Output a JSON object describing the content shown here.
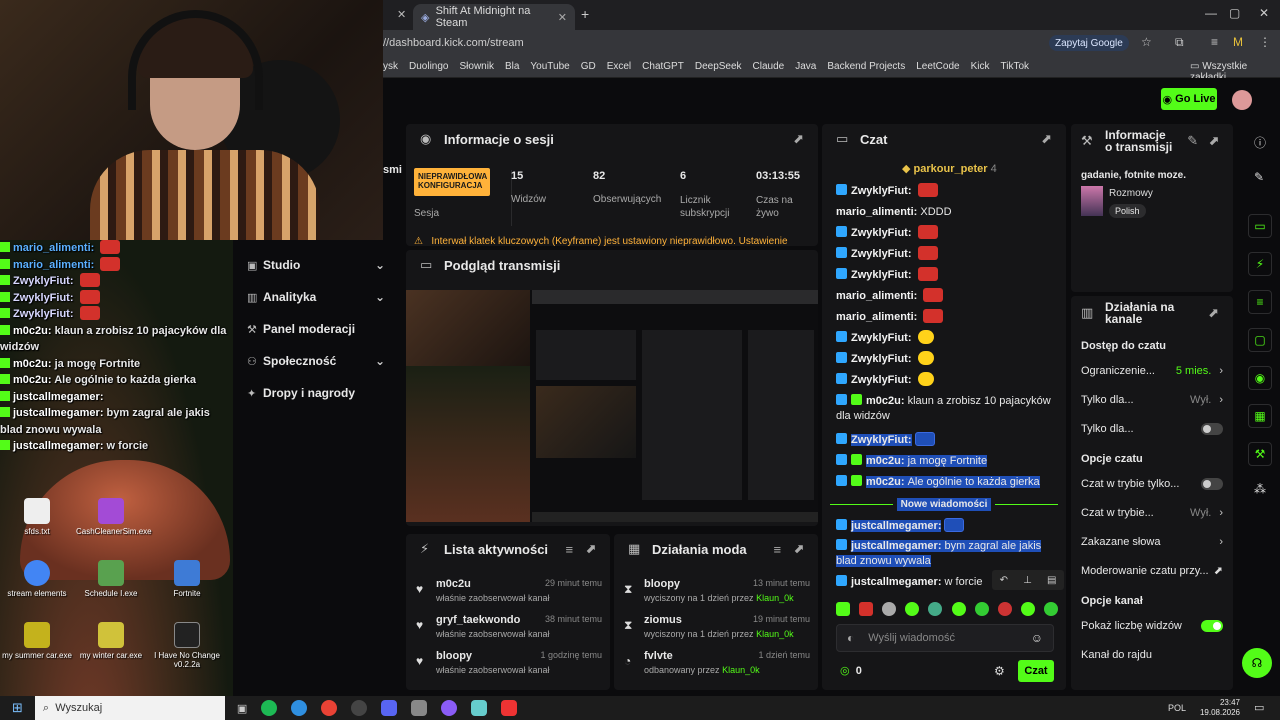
{
  "browser": {
    "tabs": [
      {
        "label": "Shift At Midnight na Steam"
      }
    ],
    "url": "//dashboard.kick.com/stream",
    "translate": "Zapytaj Google",
    "bookmarks": [
      "ysk",
      "Duolingo",
      "Słownik",
      "Bla",
      "YouTube",
      "GD",
      "Excel",
      "ChatGPT",
      "DeepSeek",
      "Claude",
      "Java",
      "Backend Projects",
      "LeetCode",
      "Kick",
      "TikTok"
    ],
    "all_bookmarks": "Wszystkie zakładki"
  },
  "header": {
    "go_live": "Go Live"
  },
  "overlay_chat": [
    {
      "user": "mario_alimenti:",
      "text": "",
      "emote": true
    },
    {
      "user": "mario_alimenti:",
      "text": "",
      "emote": true
    },
    {
      "user": "ZwyklyFiut:",
      "text": "",
      "emote": true
    },
    {
      "user": "ZwyklyFiut:",
      "text": "",
      "emote": true
    },
    {
      "user": "ZwyklyFiut:",
      "text": "",
      "emote": true
    },
    {
      "user": "m0c2u:",
      "text": "klaun a zrobisz 10 pajacyków dla widzów"
    },
    {
      "user": "m0c2u:",
      "text": "ja mogę Fortnite"
    },
    {
      "user": "m0c2u:",
      "text": "Ale ogólnie to każda gierka"
    },
    {
      "user": "justcallmegamer:",
      "text": ""
    },
    {
      "user": "justcallmegamer:",
      "text": "bym zagral ale jakis blad znowu wywala"
    },
    {
      "user": "justcallmegamer:",
      "text": "w forcie"
    }
  ],
  "desktop_icons": [
    "sfds.txt",
    "CashCleanerSim.exe",
    "stream elements",
    "Schedule I.exe",
    "Fortnite",
    "my summer car.exe",
    "my winter car.exe",
    "I Have No Change v0.2.2a"
  ],
  "nav": {
    "items": [
      {
        "label": "Studio",
        "has_arrow": true
      },
      {
        "label": "Analityka",
        "has_arrow": true
      },
      {
        "label": "Panel moderacji",
        "has_arrow": false
      },
      {
        "label": "Społeczność",
        "has_arrow": true
      },
      {
        "label": "Dropy i nagrody",
        "has_arrow": false
      }
    ]
  },
  "session": {
    "title": "Informacje o sesji",
    "status_badge": "NIEPRAWIDŁOWA KONFIGURACJA",
    "status_label": "Sesja",
    "stats": [
      {
        "value": "15",
        "label": "Widzów"
      },
      {
        "value": "82",
        "label": "Obserwujących"
      },
      {
        "value": "6",
        "label": "Licznik subskrypcji"
      },
      {
        "value": "03:13:55",
        "label": "Czas na żywo"
      }
    ],
    "warning": "Interwał klatek kluczowych (Keyframe) jest ustawiony nieprawidłowo. Ustawienie"
  },
  "preview": {
    "title": "Podgląd transmisji"
  },
  "activity": {
    "title": "Lista aktywności",
    "items": [
      {
        "name": "m0c2u",
        "desc": "właśnie zaobserwował kanał",
        "time": "29 minut temu"
      },
      {
        "name": "gryf_taekwondo",
        "desc": "właśnie zaobserwował kanał",
        "time": "38 minut temu"
      },
      {
        "name": "bloopy",
        "desc": "właśnie zaobserwował kanał",
        "time": "1 godzinę temu"
      }
    ]
  },
  "modactions": {
    "title": "Działania moda",
    "items": [
      {
        "name": "bloopy",
        "desc": "wyciszony na 1 dzień przez",
        "mod": "Klaun_0k",
        "time": "13 minut temu"
      },
      {
        "name": "ziomus",
        "desc": "wyciszony na 1 dzień przez",
        "mod": "Klaun_0k",
        "time": "19 minut temu"
      },
      {
        "name": "fvlvte",
        "desc": "odbanowany przez",
        "mod": "Klaun_0k",
        "time": "1 dzień temu"
      }
    ]
  },
  "chat": {
    "title": "Czat",
    "pinned_user": "parkour_peter",
    "pinned_count": "4",
    "messages": [
      {
        "user": "ZwyklyFiut:",
        "text": "",
        "emote": "red",
        "badge": true
      },
      {
        "user": "mario_alimenti:",
        "text": "XDDD",
        "badge": false
      },
      {
        "user": "ZwyklyFiut:",
        "text": "",
        "emote": "red",
        "badge": true
      },
      {
        "user": "ZwyklyFiut:",
        "text": "",
        "emote": "red",
        "badge": true
      },
      {
        "user": "ZwyklyFiut:",
        "text": "",
        "emote": "red",
        "badge": true
      },
      {
        "user": "mario_alimenti:",
        "text": "",
        "emote": "red",
        "badge": false
      },
      {
        "user": "mario_alimenti:",
        "text": "",
        "emote": "red",
        "badge": false
      },
      {
        "user": "ZwyklyFiut:",
        "text": "",
        "emote": "yellow",
        "badge": true
      },
      {
        "user": "ZwyklyFiut:",
        "text": "",
        "emote": "yellow",
        "badge": true
      },
      {
        "user": "ZwyklyFiut:",
        "text": "",
        "emote": "yellow",
        "badge": true
      }
    ],
    "m1_user": "m0c2u:",
    "m1_text": "klaun a zrobisz 10 pajacyków dla",
    "m1_text2": "widzów",
    "h1_user": "ZwyklyFiut:",
    "h2_user": "m0c2u:",
    "h2_text": "ja mogę Fortnite",
    "h3_user": "m0c2u:",
    "h3_text": "Ale ogólnie to każda gierka",
    "new_messages": "Nowe wiadomości",
    "n1_user": "justcallmegamer:",
    "n2_user": "justcallmegamer:",
    "n2_text": "bym zagral ale jakis blad",
    "n2_text2": "znowu wywala",
    "n3_user": "justcallmegamer:",
    "n3_text": "w forcie",
    "input_placeholder": "Wyślij wiadomość",
    "points": "0",
    "send": "Czat"
  },
  "stream_info": {
    "title": "Informacje o transmisji",
    "stream_title": "gadanie, fotnite moze.",
    "category": "Rozmowy",
    "tag": "Polish"
  },
  "channel_actions": {
    "title": "Działania na kanale",
    "sections": [
      {
        "heading": "Dostęp do czatu",
        "rows": [
          {
            "label": "Ograniczenie...",
            "value": "5 mies.",
            "kind": "arrow",
            "value_green": true
          },
          {
            "label": "Tylko dla...",
            "value": "Wył.",
            "kind": "arrow"
          },
          {
            "label": "Tylko dla...",
            "value": "",
            "kind": "toggle",
            "on": false
          }
        ]
      },
      {
        "heading": "Opcje czatu",
        "rows": [
          {
            "label": "Czat w trybie tylko...",
            "value": "",
            "kind": "toggle",
            "on": false
          },
          {
            "label": "Czat w trybie...",
            "value": "Wył.",
            "kind": "arrow"
          },
          {
            "label": "Zakazane słowa",
            "value": "",
            "kind": "arrow"
          },
          {
            "label": "Moderowanie czatu przy...",
            "value": "",
            "kind": "ext"
          }
        ]
      },
      {
        "heading": "Opcje kanał",
        "rows": [
          {
            "label": "Pokaż liczbę widzów",
            "value": "",
            "kind": "toggle",
            "on": true
          },
          {
            "label": "Kanał do rajdu",
            "value": "",
            "kind": "none"
          }
        ]
      }
    ]
  },
  "taskbar": {
    "search": "Wyszukaj",
    "lang": "POL",
    "time": "23:47",
    "date": "19.08.2026"
  }
}
